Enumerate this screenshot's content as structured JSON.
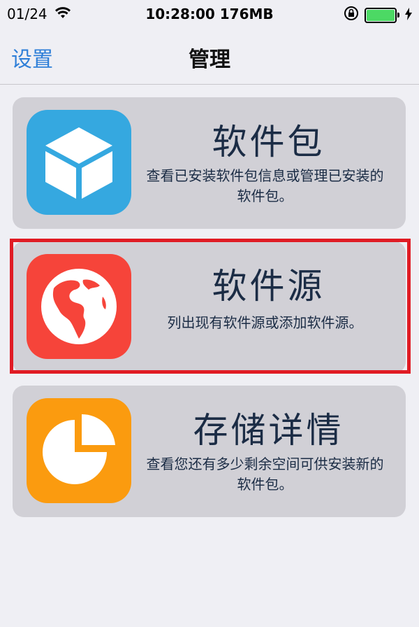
{
  "status_bar": {
    "date": "01/24",
    "time_memory": "10:28:00 176MB"
  },
  "nav": {
    "back_label": "设置",
    "title": "管理"
  },
  "cards": [
    {
      "title": "软件包",
      "description": "查看已安装软件包信息或管理已安装的软件包。",
      "icon": "package-box-icon",
      "icon_color": "#35a8e0"
    },
    {
      "title": "软件源",
      "description": "列出现有软件源或添加软件源。",
      "icon": "globe-icon",
      "icon_color": "#f6443a"
    },
    {
      "title": "存储详情",
      "description": "查看您还有多少剩余空间可供安装新的软件包。",
      "icon": "pie-chart-icon",
      "icon_color": "#fb9b0f"
    }
  ],
  "colors": {
    "accent": "#2f7fd8",
    "highlight": "#e01b24",
    "battery": "#4cd964"
  }
}
